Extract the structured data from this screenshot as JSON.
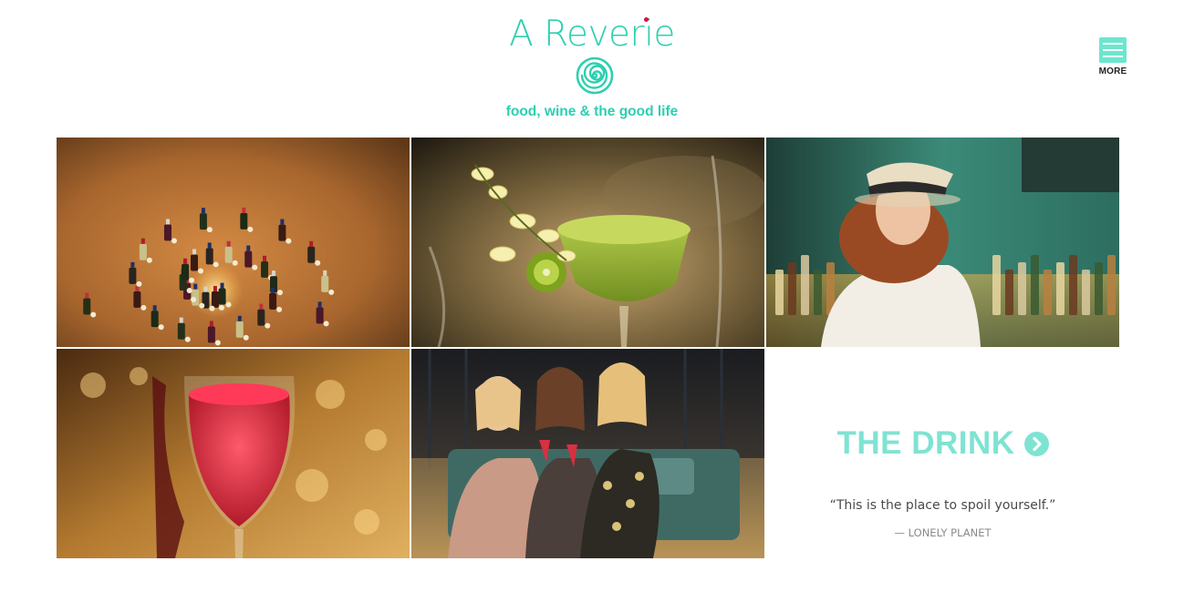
{
  "brand": {
    "name": "A Reverie",
    "tagline": "food, wine & the good life",
    "logo_icon": "spiral-icon",
    "accent_color": "#2ecfb0",
    "dot_color": "#e0103a"
  },
  "menu": {
    "label": "MORE",
    "icon": "hamburger-menu-icon"
  },
  "gallery": {
    "images": [
      {
        "name": "wine-bottle-spiral-photo"
      },
      {
        "name": "kiwi-cocktail-photo"
      },
      {
        "name": "woman-in-hat-at-bar-photo"
      },
      {
        "name": "red-sparkling-wine-glass-photo"
      },
      {
        "name": "three-friends-toasting-photo"
      }
    ]
  },
  "feature": {
    "title": "THE DRINK",
    "title_color": "#7fe3d2",
    "arrow_icon": "chevron-right-circle-icon",
    "quote": "“This is the place to spoil yourself.”",
    "attribution": "— LONELY PLANET"
  }
}
